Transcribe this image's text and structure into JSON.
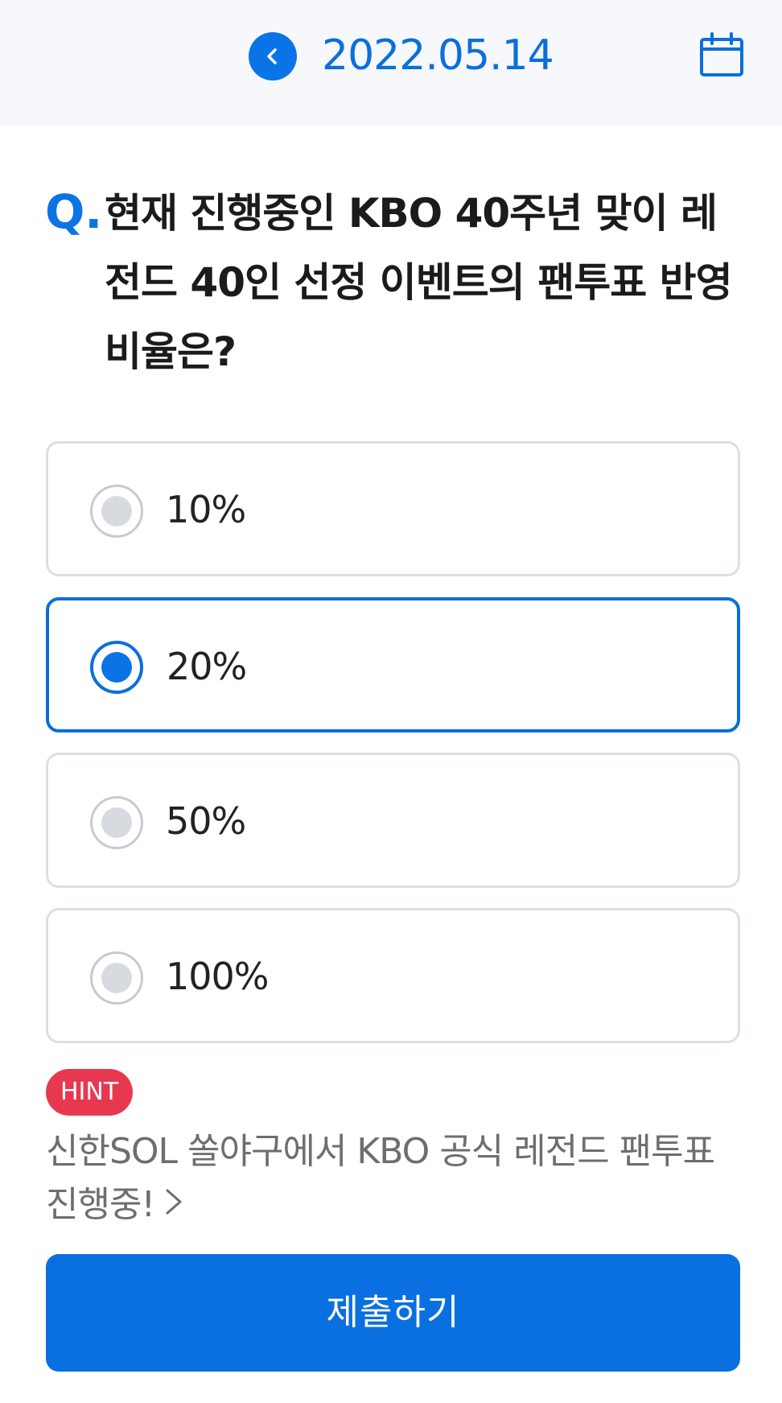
{
  "header": {
    "date": "2022.05.14",
    "back_icon": "chevron-left-icon",
    "calendar_icon": "calendar-icon",
    "accent_color": "#0a74e6"
  },
  "question": {
    "prefix": "Q.",
    "text": "현재 진행중인 KBO 40주년 맞이 레전드 40인 선정 이벤트의 팬투표 반영 비율은?"
  },
  "options": [
    {
      "label": "10%",
      "selected": false
    },
    {
      "label": "20%",
      "selected": true
    },
    {
      "label": "50%",
      "selected": false
    },
    {
      "label": "100%",
      "selected": false
    }
  ],
  "hint": {
    "badge": "HINT",
    "badge_color": "#e8384f",
    "text": "신한SOL 쏠야구에서 KBO 공식 레전드 팬투표 진행중!",
    "arrow_icon": "chevron-right-icon"
  },
  "submit": {
    "label": "제출하기"
  }
}
